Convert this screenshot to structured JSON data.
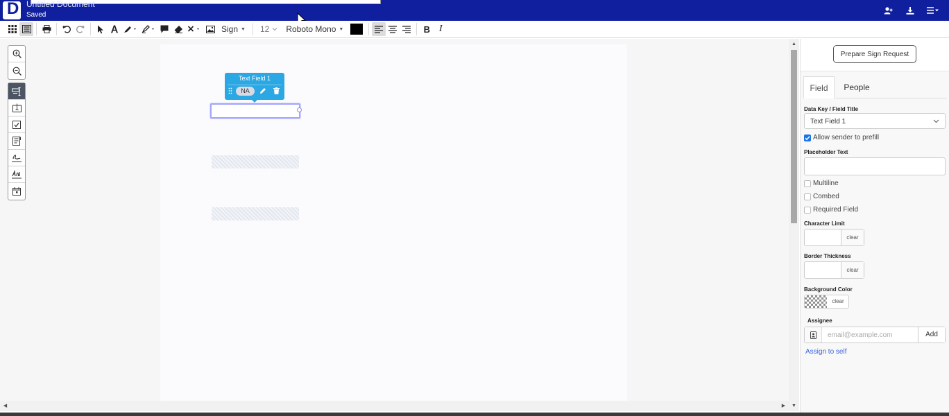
{
  "header": {
    "logo_letter": "D",
    "document_title": "Untitled Document",
    "save_status": "Saved",
    "icons": [
      "add-person-icon",
      "download-icon",
      "hamburger-menu-icon"
    ]
  },
  "toolbar": {
    "signature_dropdown": "Sign",
    "font_size": "12",
    "font_family": "Roboto Mono",
    "text_color": "#000000",
    "bold_glyph": "B",
    "italic_glyph": "I"
  },
  "tool_rail": {
    "groups": [
      [
        "zoom-in-icon",
        "zoom-out-icon"
      ],
      [
        "text-field-tool-icon",
        "text-box-tool-icon",
        "checkbox-tool-icon",
        "form-field-tool-icon",
        "signature-tool-icon",
        "initials-tool-icon",
        "date-tool-icon"
      ]
    ],
    "active": "text-field-tool-icon"
  },
  "canvas": {
    "field_popover": {
      "title": "Text Field 1",
      "tag": "NA"
    }
  },
  "panel": {
    "prepare_button": "Prepare Sign Request",
    "tabs": [
      "Field",
      "People"
    ],
    "active_tab": "Field",
    "data_key_label": "Data Key / Field Title",
    "data_key_value": "Text Field 1",
    "allow_prefill_label": "Allow sender to prefill",
    "allow_prefill_checked": true,
    "placeholder_label": "Placeholder Text",
    "placeholder_value": "",
    "multiline_label": "Multiline",
    "combed_label": "Combed",
    "required_label": "Required Field",
    "char_limit_label": "Character Limit",
    "border_thickness_label": "Border Thickness",
    "background_color_label": "Background Color",
    "clear_label": "clear",
    "assignee_label": "Assignee",
    "email_placeholder": "email@example.com",
    "add_button": "Add",
    "assign_self": "Assign to self"
  },
  "colors": {
    "header_bg": "#0f1f9e",
    "popover_bg": "#2ba7e3",
    "selection_border": "#a4a6ff",
    "link": "#3b62d6",
    "checkbox_on": "#1a73e8"
  }
}
